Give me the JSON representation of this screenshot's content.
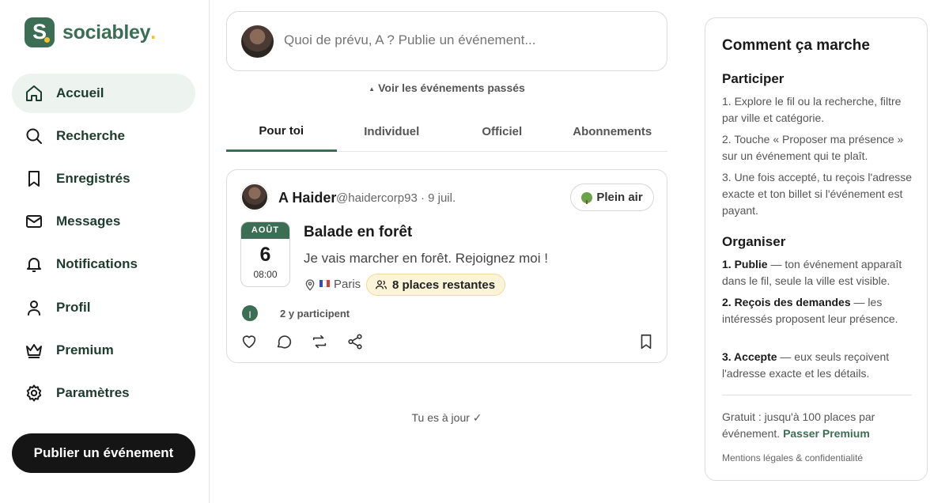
{
  "brand": {
    "name": "sociabley",
    "name_dot": ".",
    "mark_letter": "S",
    "color": "#3b6e55",
    "accent": "#f2c12e"
  },
  "sidebar": {
    "items": [
      {
        "label": "Accueil",
        "icon": "home-icon",
        "active": true
      },
      {
        "label": "Recherche",
        "icon": "search-icon"
      },
      {
        "label": "Enregistrés",
        "icon": "bookmark-icon"
      },
      {
        "label": "Messages",
        "icon": "mail-icon"
      },
      {
        "label": "Notifications",
        "icon": "bell-icon"
      },
      {
        "label": "Profil",
        "icon": "user-icon"
      },
      {
        "label": "Premium",
        "icon": "crown-icon"
      },
      {
        "label": "Paramètres",
        "icon": "gear-icon"
      }
    ],
    "publish_label": "Publier un événement"
  },
  "composer": {
    "placeholder": "Quoi de prévu, A ? Publie un événement..."
  },
  "past_events_link": "Voir les événements passés",
  "tabs": [
    {
      "label": "Pour toi",
      "active": true
    },
    {
      "label": "Individuel"
    },
    {
      "label": "Officiel"
    },
    {
      "label": "Abonnements"
    }
  ],
  "post": {
    "author": "A Haider",
    "meta": "@haidercorp93 · 9 juil.",
    "tag": "Plein air",
    "date": {
      "month": "AOÛT",
      "day": "6",
      "time": "08:00"
    },
    "title": "Balade en forêt",
    "description": "Je vais marcher en forêt. Rejoignez moi !",
    "city": "Paris",
    "places": "8 places restantes",
    "participant_initial": "I",
    "participants": "2 y participent"
  },
  "feed_end": "Tu es à jour ✓",
  "info": {
    "title": "Comment ça marche",
    "participate_heading": "Participer",
    "participate_steps": [
      "1. Explore le fil ou la recherche, filtre par ville et catégorie.",
      "2. Touche « Proposer ma présence » sur un événement qui te plaît.",
      "3. Une fois accepté, tu reçois l'adresse exacte et ton billet si l'événement est payant."
    ],
    "organize_heading": "Organiser",
    "organize_steps": [
      {
        "bold": "1. Publie",
        "text": " — ton événement apparaît dans le fil, seule la ville est visible."
      },
      {
        "bold": "2. Reçois des demandes",
        "text": " — les intéressés proposent leur présence."
      },
      {
        "bold": "3. Accepte",
        "text": " — eux seuls reçoivent l'adresse exacte et les détails."
      }
    ],
    "free_text": "Gratuit : jusqu'à 100 places par événement. ",
    "premium_link": "Passer Premium",
    "legal": "Mentions légales & confidentialité"
  }
}
